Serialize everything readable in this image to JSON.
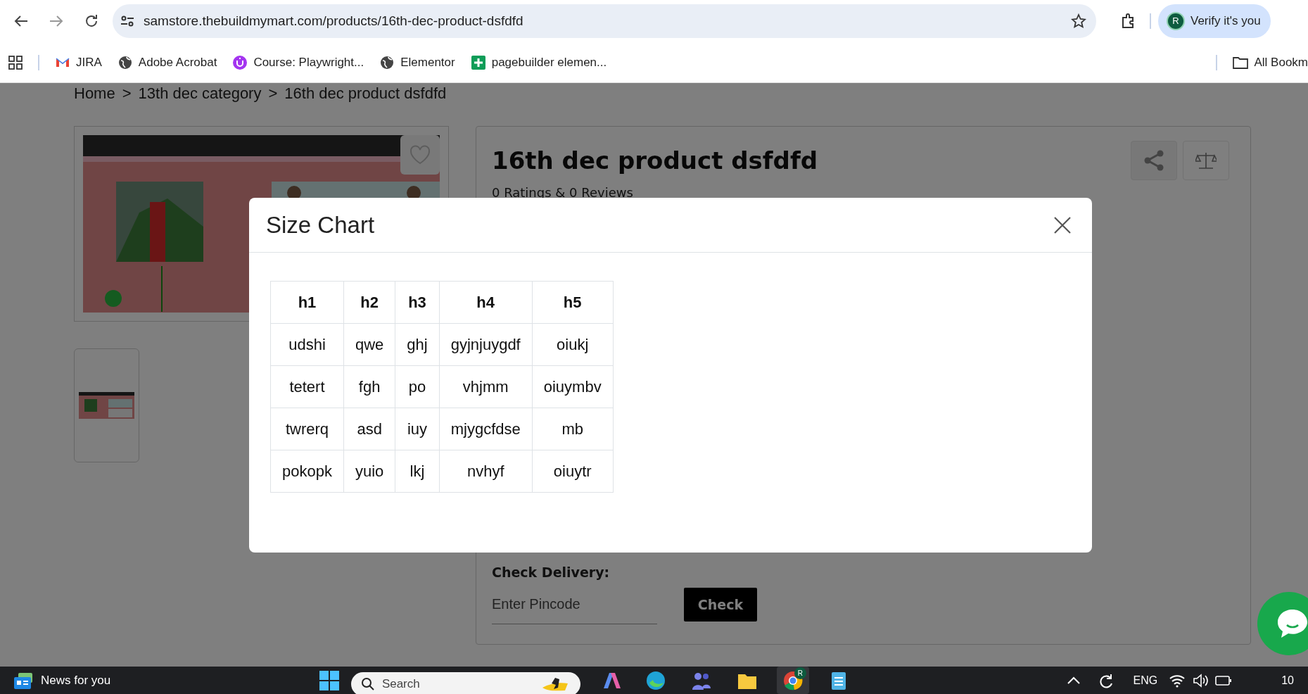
{
  "browser": {
    "url": "samstore.thebuildmymart.com/products/16th-dec-product-dsfdfd",
    "profile_initial": "R",
    "profile_label": "Verify it's you"
  },
  "bookmarks": [
    {
      "label": "JIRA",
      "kind": "mail"
    },
    {
      "label": "Adobe Acrobat",
      "kind": "globe"
    },
    {
      "label": "Course: Playwright...",
      "kind": "course"
    },
    {
      "label": "Elementor",
      "kind": "globe"
    },
    {
      "label": "pagebuilder elemen...",
      "kind": "sheet"
    }
  ],
  "all_bookmarks": "All Bookm",
  "breadcrumb": {
    "separator": ">",
    "items": [
      "Home",
      "13th dec category",
      "16th dec product dsfdfd"
    ]
  },
  "product": {
    "title": "16th dec product dsfdfd",
    "ratings": "0 Ratings & 0 Reviews"
  },
  "delivery": {
    "label": "Check Delivery:",
    "placeholder": "Enter Pincode",
    "button": "Check"
  },
  "modal": {
    "title": "Size Chart",
    "table": {
      "columns": [
        "h1",
        "h2",
        "h3",
        "h4",
        "h5"
      ],
      "rows": [
        [
          "udshi",
          "qwe",
          "ghj",
          "gyjnjuygdf",
          "oiukj"
        ],
        [
          "tetert",
          "fgh",
          "po",
          "vhjmm",
          "oiuymbv"
        ],
        [
          "twrerq",
          "asd",
          "iuy",
          "mjygcfdse",
          "mb"
        ],
        [
          "pokopk",
          "yuio",
          "lkj",
          "nvhyf",
          "oiuytr"
        ]
      ]
    }
  },
  "taskbar": {
    "news": "News for you",
    "search_placeholder": "Search",
    "chrome_badge": "R",
    "language": "ENG",
    "time": "10"
  }
}
